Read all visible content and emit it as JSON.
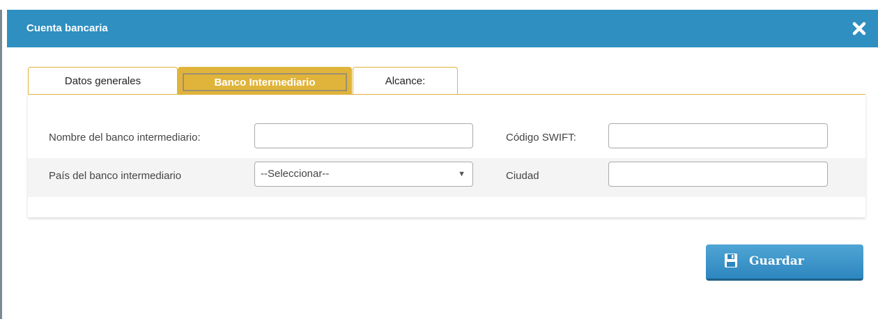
{
  "dialog": {
    "title": "Cuenta bancaria",
    "close_icon": "close-icon"
  },
  "tabs": [
    {
      "label": "Datos generales",
      "active": false
    },
    {
      "label": "Banco Intermediario",
      "active": true
    },
    {
      "label": "Alcance:",
      "active": false
    }
  ],
  "form": {
    "bank_name_label": "Nombre del banco intermediario:",
    "bank_name_value": "",
    "swift_label": "Código SWIFT:",
    "swift_value": "",
    "country_label": "País del banco intermediario",
    "country_selected": "--Seleccionar--",
    "city_label": "Ciudad",
    "city_value": ""
  },
  "actions": {
    "save_label": "Guardar",
    "save_icon": "floppy-disk-icon"
  },
  "colors": {
    "titlebar": "#2f8fc1",
    "tab_accent": "#e0b43a",
    "button": "#2d86bf"
  }
}
